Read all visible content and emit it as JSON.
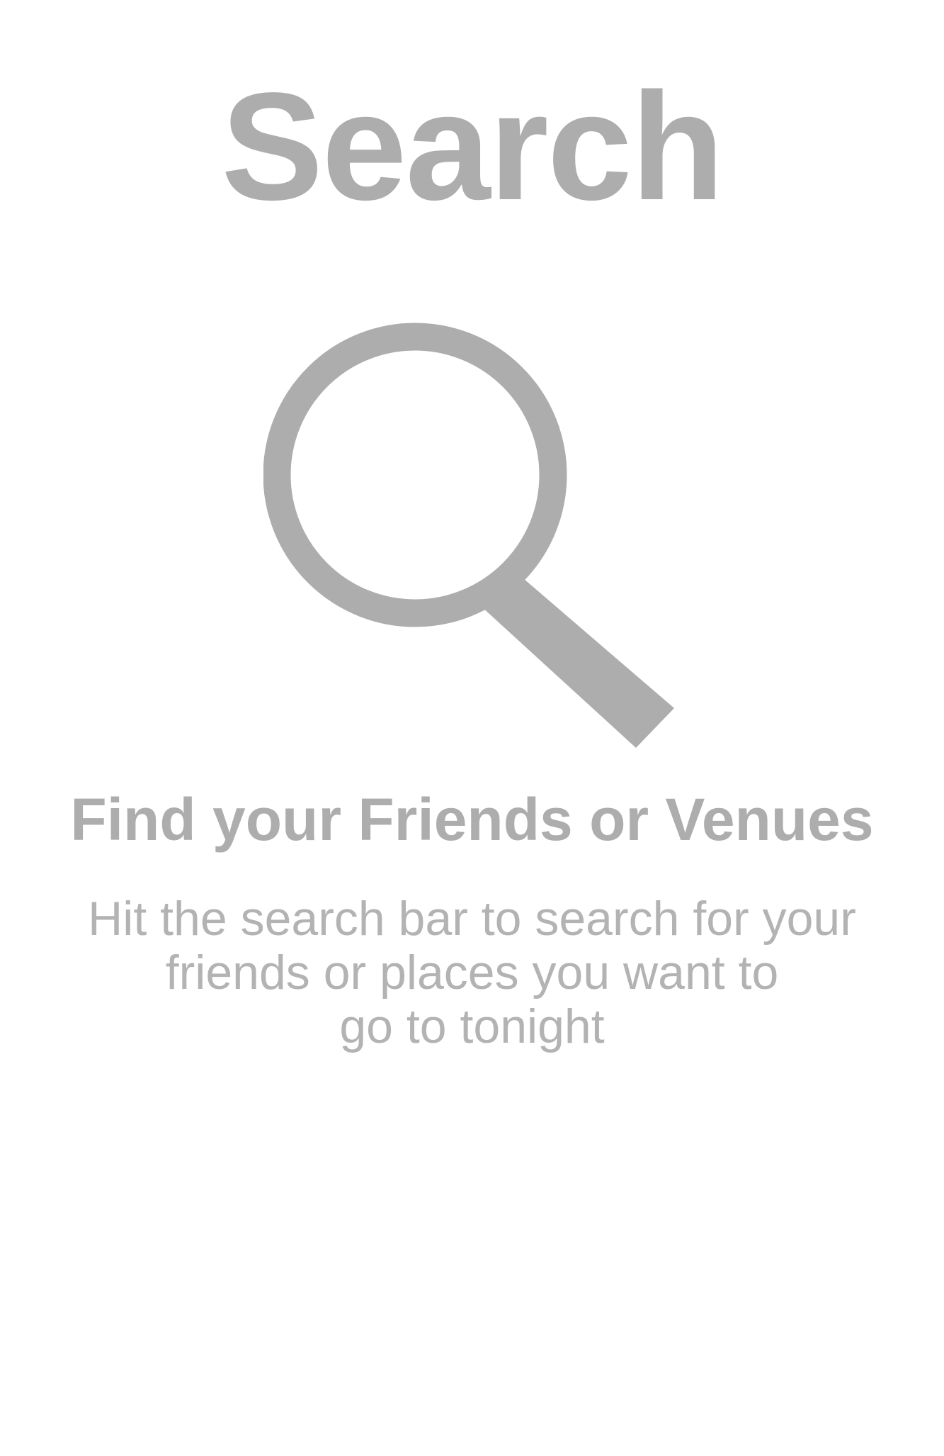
{
  "header": {
    "title": "Search"
  },
  "empty_state": {
    "icon": "magnifying-glass-icon",
    "heading": "Find your Friends or Venues",
    "description_lines": [
      "Hit the search bar to search for your",
      "friends or places you want to",
      "go to tonight"
    ]
  },
  "colors": {
    "text": "#adadad",
    "icon": "#adadad",
    "background": "#ffffff"
  }
}
